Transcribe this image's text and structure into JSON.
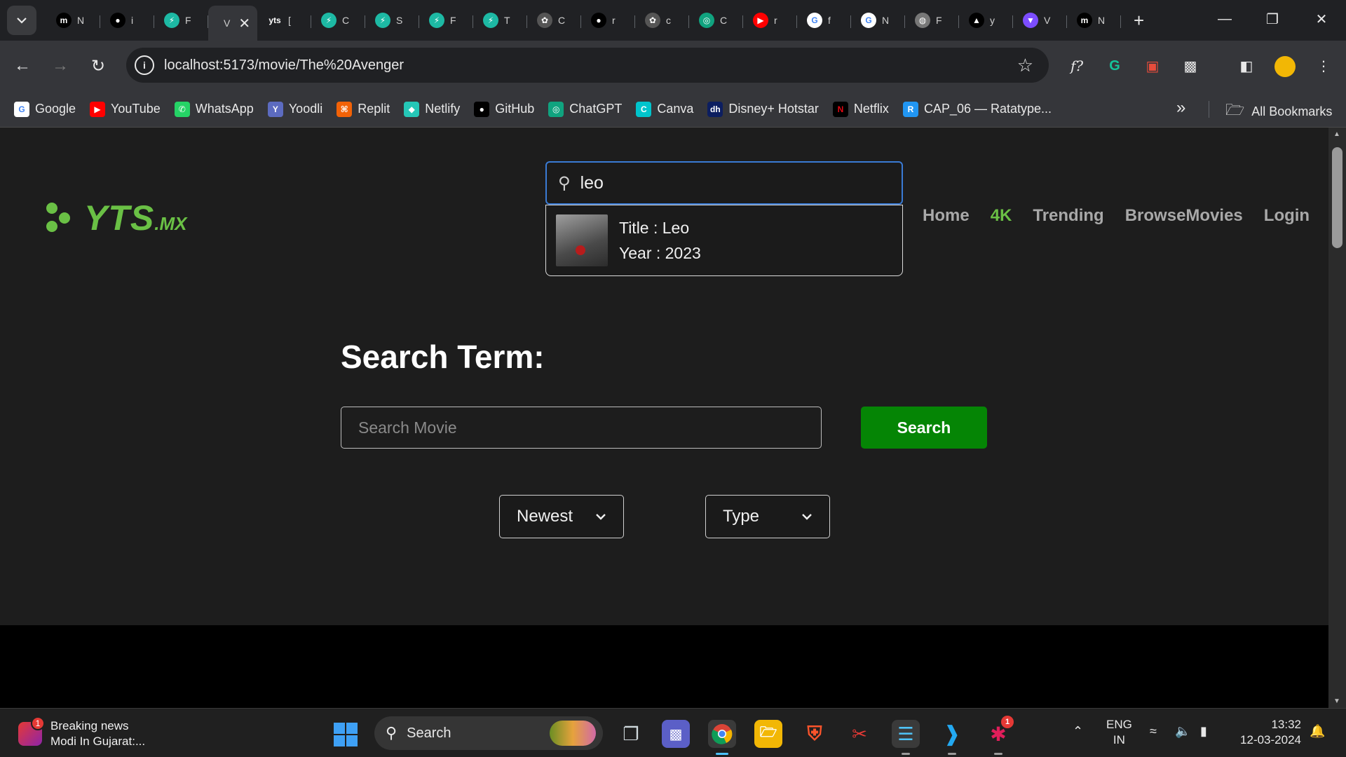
{
  "browser": {
    "tabs": [
      {
        "letter": "N",
        "color": "#ffffff",
        "bg": "#000000",
        "glyph": "m"
      },
      {
        "letter": "i",
        "color": "#ffffff",
        "bg": "#000000",
        "glyph": "gh"
      },
      {
        "letter": "F",
        "color": "#ffffff",
        "bg": "#1db9a4",
        "glyph": "⚡"
      },
      {
        "letter": "V",
        "color": "#ffffff",
        "bg": "",
        "glyph": "",
        "active": true
      },
      {
        "letter": "[",
        "color": "#6ac045",
        "bg": "",
        "glyph": "yts"
      },
      {
        "letter": "C",
        "color": "#ffffff",
        "bg": "#1db9a4",
        "glyph": "⚡"
      },
      {
        "letter": "S",
        "color": "#ffffff",
        "bg": "#1db9a4",
        "glyph": "⚡"
      },
      {
        "letter": "F",
        "color": "#ffffff",
        "bg": "#1db9a4",
        "glyph": "⚡"
      },
      {
        "letter": "T",
        "color": "#ffffff",
        "bg": "#1db9a4",
        "glyph": "⚡"
      },
      {
        "letter": "C",
        "color": "#ffffff",
        "bg": "#555555",
        "glyph": "✿"
      },
      {
        "letter": "r",
        "color": "#ffffff",
        "bg": "#000000",
        "glyph": "gh"
      },
      {
        "letter": "c",
        "color": "#ffffff",
        "bg": "#555555",
        "glyph": "✿"
      },
      {
        "letter": "C",
        "color": "#ffffff",
        "bg": "#10a37f",
        "glyph": "◎"
      },
      {
        "letter": "r",
        "color": "#ffffff",
        "bg": "#ff0000",
        "glyph": "▶"
      },
      {
        "letter": "f",
        "color": "#ffffff",
        "bg": "#ffffff",
        "glyph": "G"
      },
      {
        "letter": "N",
        "color": "#ffffff",
        "bg": "#ffffff",
        "glyph": "G"
      },
      {
        "letter": "F",
        "color": "#ffffff",
        "bg": "#777777",
        "glyph": "◍"
      },
      {
        "letter": "y",
        "color": "#ffffff",
        "bg": "#000000",
        "glyph": "▲"
      },
      {
        "letter": "V",
        "color": "#ffffff",
        "bg": "#7c4dff",
        "glyph": "▼"
      },
      {
        "letter": "N",
        "color": "#ffffff",
        "bg": "#000000",
        "glyph": "m"
      }
    ],
    "url": "localhost:5173/movie/The%20Avenger",
    "bookmarks": [
      {
        "label": "Google",
        "icon": "google-icon",
        "color": "#ffffff",
        "glyph": "G",
        "fg": "#4285f4"
      },
      {
        "label": "YouTube",
        "icon": "youtube-icon",
        "color": "#ff0000",
        "glyph": "▶",
        "fg": "#ffffff"
      },
      {
        "label": "WhatsApp",
        "icon": "whatsapp-icon",
        "color": "#25d366",
        "glyph": "✆",
        "fg": "#ffffff"
      },
      {
        "label": "Yoodli",
        "icon": "yoodli-icon",
        "color": "#5c6bc0",
        "glyph": "Y",
        "fg": "#ffffff"
      },
      {
        "label": "Replit",
        "icon": "replit-icon",
        "color": "#f26207",
        "glyph": "⌘",
        "fg": "#ffffff"
      },
      {
        "label": "Netlify",
        "icon": "netlify-icon",
        "color": "#25c7b7",
        "glyph": "◆",
        "fg": "#ffffff"
      },
      {
        "label": "GitHub",
        "icon": "github-icon",
        "color": "#000000",
        "glyph": "●",
        "fg": "#ffffff"
      },
      {
        "label": "ChatGPT",
        "icon": "chatgpt-icon",
        "color": "#10a37f",
        "glyph": "◎",
        "fg": "#ffffff"
      },
      {
        "label": "Canva",
        "icon": "canva-icon",
        "color": "#00c4cc",
        "glyph": "C",
        "fg": "#ffffff"
      },
      {
        "label": "Disney+ Hotstar",
        "icon": "hotstar-icon",
        "color": "#0c1e60",
        "glyph": "dh",
        "fg": "#ffffff"
      },
      {
        "label": "Netflix",
        "icon": "netflix-icon",
        "color": "#000000",
        "glyph": "N",
        "fg": "#e50914"
      },
      {
        "label": "CAP_06 — Ratatype...",
        "icon": "ratatype-icon",
        "color": "#2196f3",
        "glyph": "R",
        "fg": "#ffffff"
      }
    ],
    "all_bookmarks": "All Bookmarks"
  },
  "page": {
    "logo_text": "YTS",
    "logo_suffix": ".MX",
    "top_search_value": "leo",
    "suggestion": {
      "title": "Title : Leo",
      "year": "Year : 2023"
    },
    "nav": [
      {
        "label": "Home",
        "active": false
      },
      {
        "label": "4K",
        "active": true
      },
      {
        "label": "Trending",
        "active": false
      },
      {
        "label": "BrowseMovies",
        "active": false
      },
      {
        "label": "Login",
        "active": false
      }
    ],
    "heading": "Search Term:",
    "search_placeholder": "Search Movie",
    "search_button": "Search",
    "sort_select": "Newest",
    "type_select": "Type",
    "accent_color": "#6ac045",
    "button_color": "#058505"
  },
  "taskbar": {
    "news_title": "Breaking news",
    "news_sub": "Modi In Gujarat:...",
    "news_badge": "1",
    "search_label": "Search",
    "lang_top": "ENG",
    "lang_bottom": "IN",
    "time": "13:32",
    "date": "12-03-2024",
    "slack_badge": "1"
  }
}
